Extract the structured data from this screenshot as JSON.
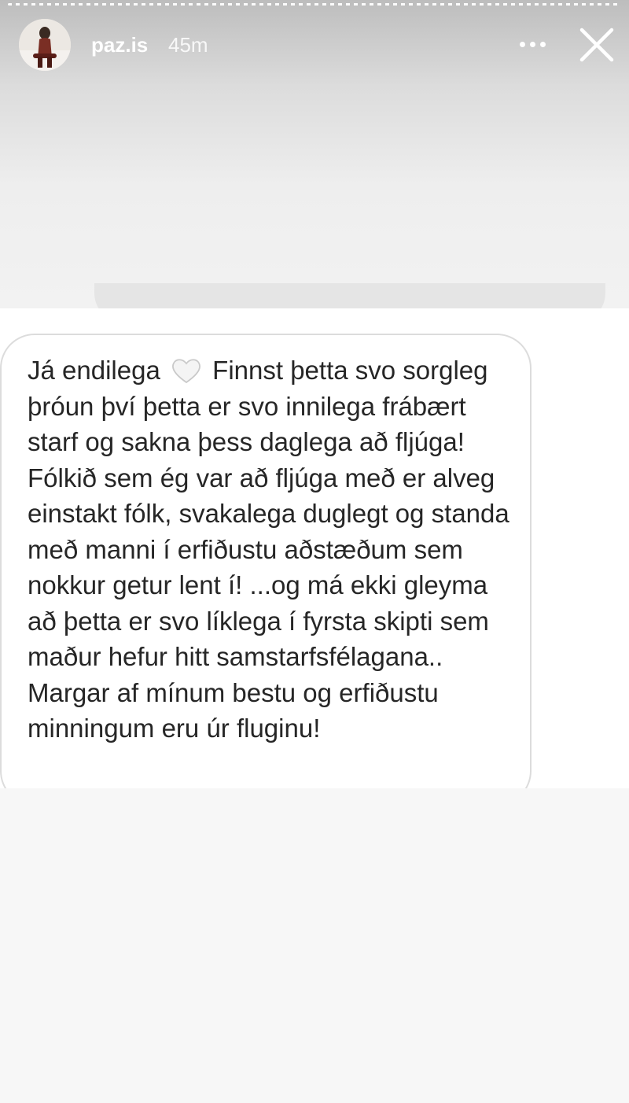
{
  "story": {
    "username": "paz.is",
    "timestamp": "45m"
  },
  "icons": {
    "avatar": "profile-photo",
    "more": "more-dots-icon",
    "close": "close-icon",
    "heart": "white-heart-emoji"
  },
  "message": {
    "line_1_start": "Já endilega",
    "line_1_end": "Finnst þetta svo sorgleg þróun því þetta er svo innilega frábært starf og sakna þess daglega að fljúga! Fólkið sem ég var að fljúga með er alveg einstakt fólk, svakalega duglegt og standa með manni í erfiðustu aðstæðum sem nokkur getur lent í! ...og má ekki gleyma að þetta er svo líklega í fyrsta skipti sem maður hefur hitt samstarfsfélagana..",
    "paragraph_2": "Margar af mínum bestu og erfiðustu minningum eru úr fluginu!"
  },
  "colors": {
    "text": "#262626",
    "bubble_border": "#dcdcdc",
    "header_text": "#ffffff"
  }
}
